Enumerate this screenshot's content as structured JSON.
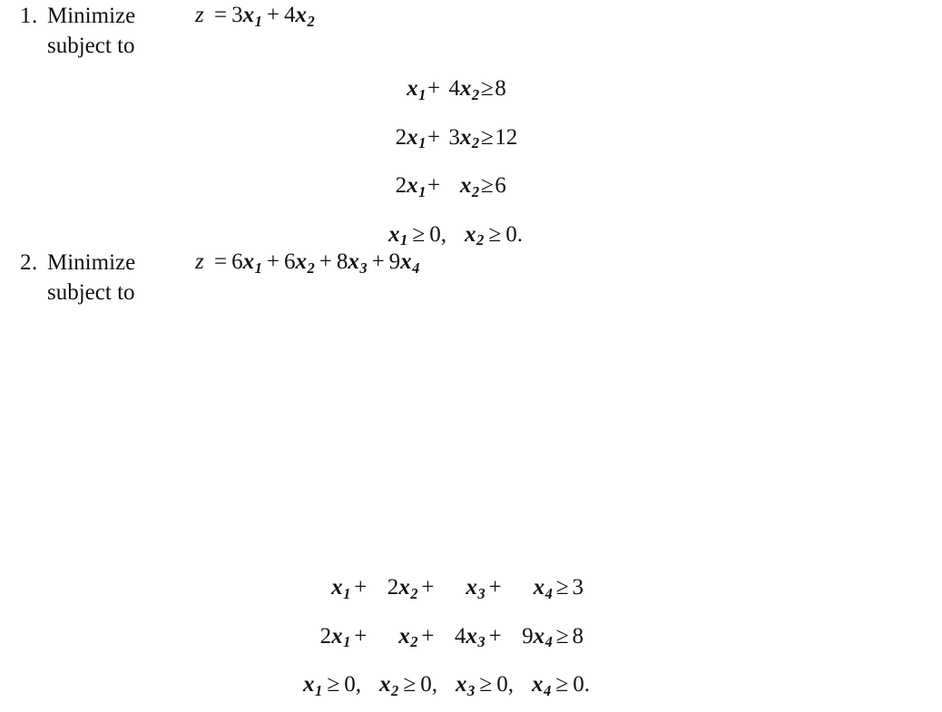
{
  "page": {
    "background_color": "#ffffff",
    "text_color": "#111111",
    "kind": "textbook-exercise-list"
  },
  "problems": [
    {
      "number": "1.",
      "minimize_label": "Minimize",
      "subject_label": "subject to",
      "objective": {
        "lhs": "z",
        "equals": "=",
        "terms": [
          {
            "coef": "3",
            "var": "x",
            "sub": "1"
          },
          {
            "coef": "4",
            "var": "x",
            "sub": "2"
          }
        ],
        "plain": "z = 3x1 + 4x2"
      },
      "constraints": [
        {
          "terms": [
            {
              "coef": "",
              "var": "x",
              "sub": "1"
            },
            {
              "coef": "4",
              "var": "x",
              "sub": "2"
            }
          ],
          "relation": "≥",
          "rhs": "8",
          "plain": "x1 + 4x2 ≥ 8"
        },
        {
          "terms": [
            {
              "coef": "2",
              "var": "x",
              "sub": "1"
            },
            {
              "coef": "3",
              "var": "x",
              "sub": "2"
            }
          ],
          "relation": "≥",
          "rhs": "12",
          "plain": "2x1 + 3x2 ≥ 12"
        },
        {
          "terms": [
            {
              "coef": "2",
              "var": "x",
              "sub": "1"
            },
            {
              "coef": "",
              "var": "x",
              "sub": "2"
            }
          ],
          "relation": "≥",
          "rhs": "6",
          "plain": "2x1 + x2 ≥ 6"
        }
      ],
      "nonnegativity": {
        "items": [
          {
            "var": "x",
            "sub": "1",
            "relation": "≥",
            "rhs": "0",
            "trailing": ","
          },
          {
            "var": "x",
            "sub": "2",
            "relation": "≥",
            "rhs": "0",
            "trailing": "."
          }
        ],
        "plain": "x1 ≥ 0,  x2 ≥ 0."
      }
    },
    {
      "number": "2.",
      "minimize_label": "Minimize",
      "subject_label": "subject to",
      "objective": {
        "lhs": "z",
        "equals": "=",
        "terms": [
          {
            "coef": "6",
            "var": "x",
            "sub": "1"
          },
          {
            "coef": "6",
            "var": "x",
            "sub": "2"
          },
          {
            "coef": "8",
            "var": "x",
            "sub": "3"
          },
          {
            "coef": "9",
            "var": "x",
            "sub": "4"
          }
        ],
        "plain": "z = 6x1 + 6x2 + 8x3 + 9x4"
      },
      "constraints": [
        {
          "terms": [
            {
              "coef": "",
              "var": "x",
              "sub": "1"
            },
            {
              "coef": "2",
              "var": "x",
              "sub": "2"
            },
            {
              "coef": "",
              "var": "x",
              "sub": "3"
            },
            {
              "coef": "",
              "var": "x",
              "sub": "4"
            }
          ],
          "relation": "≥",
          "rhs": "3",
          "plain": "x1 + 2x2 + x3 + x4 ≥ 3"
        },
        {
          "terms": [
            {
              "coef": "2",
              "var": "x",
              "sub": "1"
            },
            {
              "coef": "",
              "var": "x",
              "sub": "2"
            },
            {
              "coef": "4",
              "var": "x",
              "sub": "3"
            },
            {
              "coef": "9",
              "var": "x",
              "sub": "4"
            }
          ],
          "relation": "≥",
          "rhs": "8",
          "plain": "2x1 + x2 + 4x3 + 9x4 ≥ 8"
        }
      ],
      "nonnegativity": {
        "items": [
          {
            "var": "x",
            "sub": "1",
            "relation": "≥",
            "rhs": "0",
            "trailing": ","
          },
          {
            "var": "x",
            "sub": "2",
            "relation": "≥",
            "rhs": "0",
            "trailing": ","
          },
          {
            "var": "x",
            "sub": "3",
            "relation": "≥",
            "rhs": "0",
            "trailing": ","
          },
          {
            "var": "x",
            "sub": "4",
            "relation": "≥",
            "rhs": "0",
            "trailing": "."
          }
        ],
        "plain": "x1 ≥ 0,  x2 ≥ 0,  x3 ≥ 0,  x4 ≥ 0."
      }
    }
  ],
  "symbols": {
    "plus": "+",
    "equals": "=",
    "geq": "≥"
  }
}
